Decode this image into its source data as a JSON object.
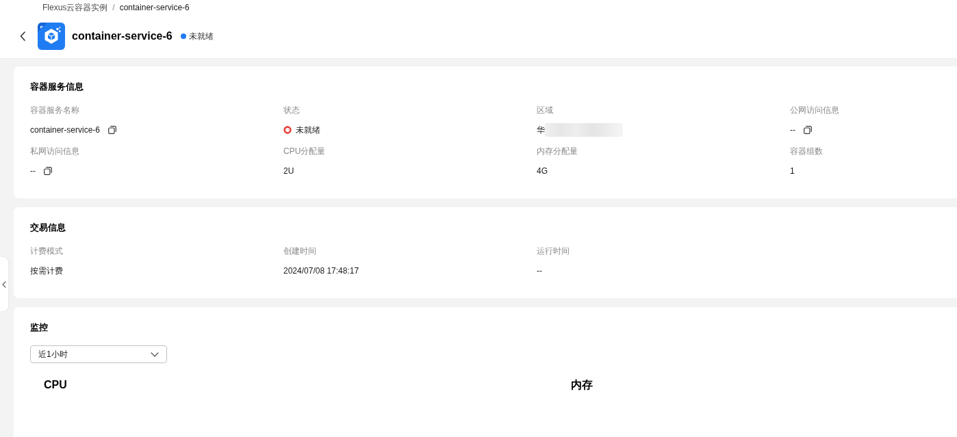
{
  "breadcrumb": {
    "separator": "/",
    "items": [
      {
        "label": "Flexus云容器实例"
      },
      {
        "label": "container-service-6"
      }
    ]
  },
  "header": {
    "title": "container-service-6",
    "status": "未就绪"
  },
  "sections": [
    {
      "title": "容器服务信息",
      "fields": [
        {
          "label": "容器服务名称",
          "value": "container-service-6",
          "kind": "copyable"
        },
        {
          "label": "状态",
          "value": "未就绪",
          "kind": "status"
        },
        {
          "label": "区域",
          "value": "华",
          "kind": "masked"
        },
        {
          "label": "公网访问信息",
          "value": "--",
          "kind": "copyable"
        },
        {
          "label": "私网访问信息",
          "value": "--",
          "kind": "copyable"
        },
        {
          "label": "CPU分配量",
          "value": "2U",
          "kind": "text"
        },
        {
          "label": "内存分配量",
          "value": "4G",
          "kind": "text"
        },
        {
          "label": "容器组数",
          "value": "1",
          "kind": "text"
        }
      ]
    },
    {
      "title": "交易信息",
      "fields": [
        {
          "label": "计费模式",
          "value": "按需计费",
          "kind": "text"
        },
        {
          "label": "创建时间",
          "value": "2024/07/08 17:48:17",
          "kind": "text"
        },
        {
          "label": "运行时间",
          "value": "--",
          "kind": "text"
        }
      ]
    }
  ],
  "monitoring": {
    "title": "监控",
    "time_range": {
      "value": "近1小时"
    },
    "charts": [
      {
        "title": "CPU"
      },
      {
        "title": "内存"
      }
    ]
  }
}
